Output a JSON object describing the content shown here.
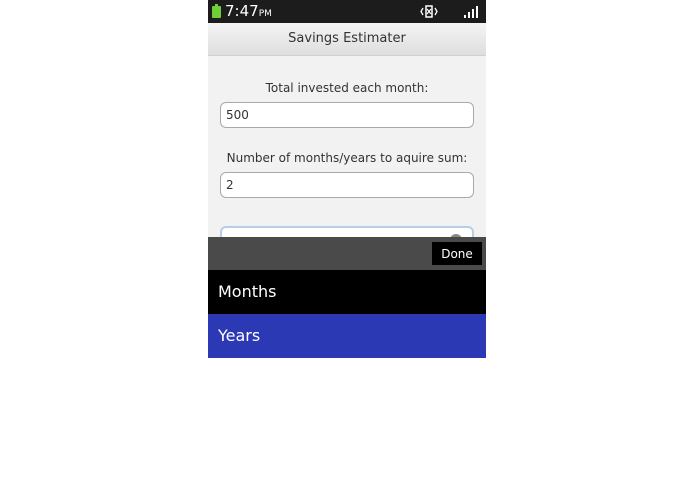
{
  "status_bar": {
    "time": "7:47",
    "ampm": "PM",
    "battery_icon": "battery-icon",
    "vibrate_icon": "vibrate-icon",
    "signal_icon": "signal-icon"
  },
  "app": {
    "title": "Savings Estimater"
  },
  "form": {
    "monthly_label": "Total invested each month:",
    "monthly_value": "500",
    "period_label": "Number of months/years to aquire sum:",
    "period_value": "2"
  },
  "picker": {
    "done_label": "Done",
    "options": [
      "Months",
      "Years"
    ],
    "selected": "Years",
    "selected_color": "#2b39b5"
  }
}
